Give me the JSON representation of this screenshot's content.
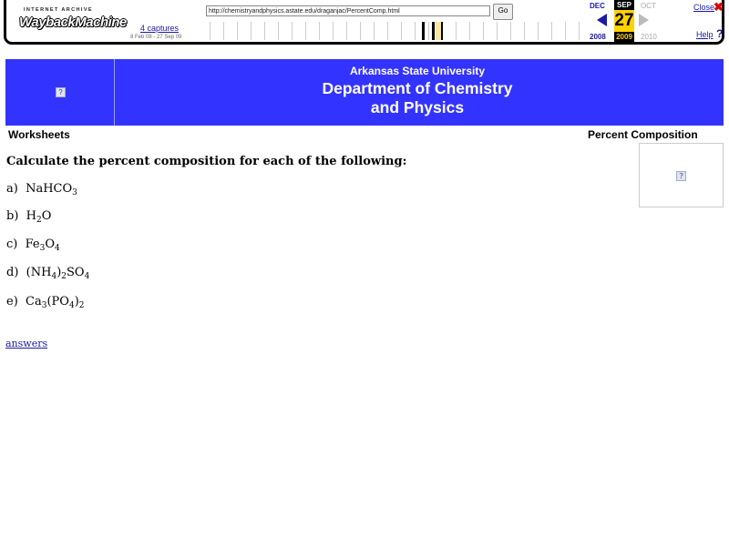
{
  "wayback": {
    "logo_top": "INTERNET ARCHIVE",
    "logo_main": "WaybackMachine",
    "url": "http://chemistryandphysics.astate.edu/draganjac/PercentComp.html",
    "go_label": "Go",
    "captures": "4 captures",
    "range": "8 Feb 08 - 27 Sep 09",
    "month_prev": "DEC",
    "month_cur": "SEP",
    "month_next": "OCT",
    "day": "27",
    "year_prev": "2008",
    "year_cur": "2009",
    "year_next": "2010",
    "close_label": "Close",
    "help_label": "Help",
    "colors": {
      "link": "#1a1aa8",
      "highlight": "#ffd200",
      "close": "#dd0000"
    }
  },
  "header": {
    "university": "Arkansas State University",
    "department_line1": "Department of Chemistry",
    "department_line2": "and Physics",
    "banner_color": "#3333ff"
  },
  "nav": {
    "worksheets": "Worksheets",
    "page_title": "Percent Composition"
  },
  "content": {
    "instructions": "Calculate the percent composition for each of the following:",
    "problems": [
      {
        "letter": "a)",
        "parts": [
          "NaHCO",
          "3"
        ]
      },
      {
        "letter": "b)",
        "parts": [
          "H",
          "2",
          "O"
        ]
      },
      {
        "letter": "c)",
        "parts": [
          "Fe",
          "3",
          "O",
          "4"
        ]
      },
      {
        "letter": "d)",
        "parts": [
          "(NH",
          "4",
          ")",
          "2",
          "SO",
          "4"
        ]
      },
      {
        "letter": "e)",
        "parts": [
          "Ca",
          "3",
          "(PO",
          "4",
          ")",
          "2"
        ]
      }
    ],
    "answers_link": "answers"
  },
  "icons": {
    "broken_image": "broken-image-icon",
    "close": "close-x-icon",
    "help": "question-mark-icon"
  }
}
